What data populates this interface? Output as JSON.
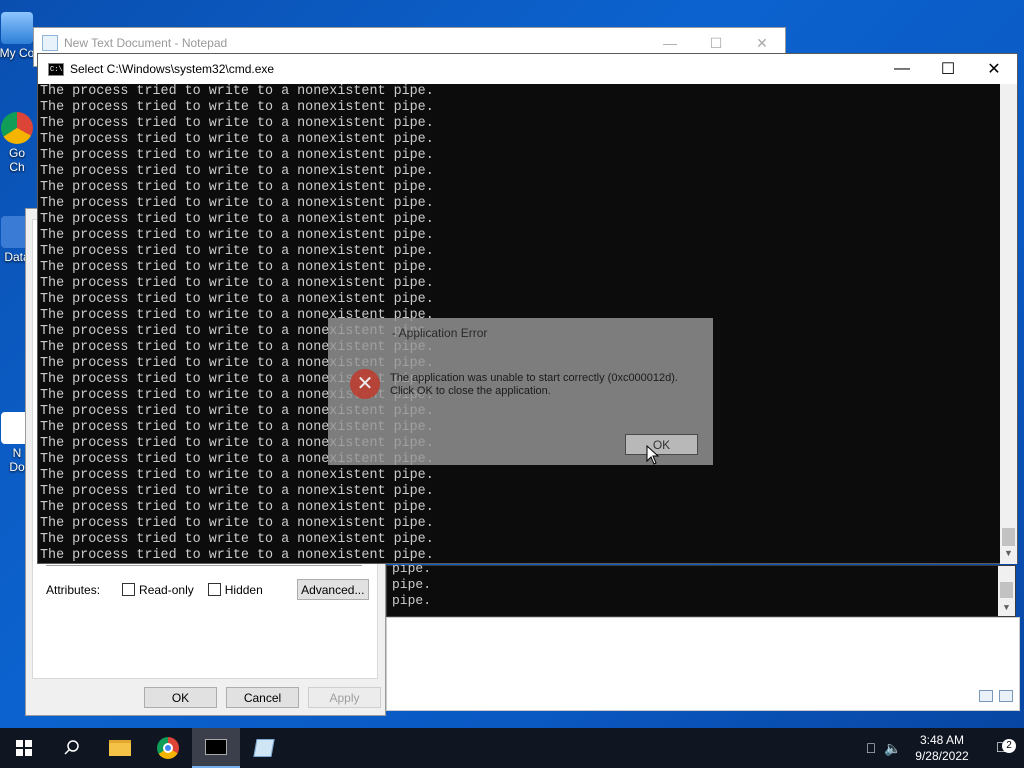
{
  "desktop": {
    "icons": [
      {
        "label": "My Co",
        "icon": "computer-icon"
      },
      {
        "label": "Go\nCh",
        "icon": "chrome-shortcut-icon"
      },
      {
        "label": "Data",
        "icon": "data-shortcut-icon"
      },
      {
        "label": "N\nDo",
        "icon": "document-icon"
      }
    ]
  },
  "notepad": {
    "title": "New Text Document - Notepad",
    "controls": [
      "—",
      "☐",
      "✕"
    ]
  },
  "properties": {
    "attributes_label": "Attributes:",
    "readonly_label": "Read-only",
    "hidden_label": "Hidden",
    "advanced_label": "Advanced...",
    "ok_label": "OK",
    "cancel_label": "Cancel",
    "apply_label": "Apply"
  },
  "cmd": {
    "title": "Select C:\\Windows\\system32\\cmd.exe",
    "icon_text": "C:\\",
    "lines": [
      "The process tried to write to a nonexistent pipe.",
      "The process tried to write to a nonexistent pipe.",
      "The process tried to write to a nonexistent pipe.",
      "The process tried to write to a nonexistent pipe.",
      "The process tried to write to a nonexistent pipe.",
      "The process tried to write to a nonexistent pipe.",
      "The process tried to write to a nonexistent pipe.",
      "The process tried to write to a nonexistent pipe.",
      "The process tried to write to a nonexistent pipe.",
      "The process tried to write to a nonexistent pipe.",
      "The process tried to write to a nonexistent pipe.",
      "The process tried to write to a nonexistent pipe.",
      "The process tried to write to a nonexistent pipe.",
      "The process tried to write to a nonexistent pipe.",
      "The process tried to write to a nonexistent pipe.",
      "The process tried to write to a nonexistent pipe.",
      "The process tried to write to a nonexistent pipe.",
      "The process tried to write to a nonexistent pipe.",
      "The process tried to write to a nonexistent pipe.",
      "The process tried to write to a nonexistent pipe.",
      "The process tried to write to a nonexistent pipe.",
      "The process tried to write to a nonexistent pipe.",
      "The process tried to write to a nonexistent pipe.",
      "The process tried to write to a nonexistent pipe.",
      "The process tried to write to a nonexistent pipe.",
      "The process tried to write to a nonexistent pipe.",
      "The process tried to write to a nonexistent pipe.",
      "The process tried to write to a nonexistent pipe.",
      "The process tried to write to a nonexistent pipe.",
      "The process tried to write to a nonexistent pipe."
    ]
  },
  "cmd_secondary": {
    "lines": [
      "pipe.",
      "pipe.",
      "pipe."
    ]
  },
  "app_error": {
    "title": "- Application Error",
    "message_line1": "The application was unable to start correctly (0xc000012d).",
    "message_line2": "Click OK to close the application.",
    "ok_label": "OK"
  },
  "taskbar": {
    "time": "3:48 AM",
    "date": "9/28/2022",
    "notification_count": "2"
  }
}
